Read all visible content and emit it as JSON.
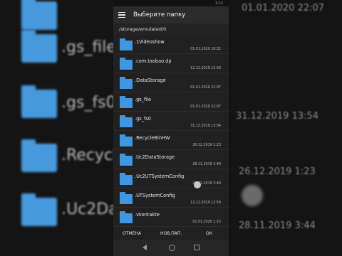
{
  "background": {
    "left_labels": [
      ".gs_file-",
      ".gs_fs0",
      ".Recycl",
      ".Uc2Da"
    ],
    "right_dates": [
      "01.01.2020 22:07",
      "31.12.2019 13:54",
      "26.12.2019 1:23",
      "28.11.2019 3:44"
    ]
  },
  "status_bar": {
    "time": "1:12"
  },
  "dialog": {
    "title": "Выберите папку",
    "path": "/storage/emulated/0",
    "folders": [
      {
        "name": ".1Videoshow",
        "date": "01.01.2020 18:32"
      },
      {
        "name": ".com.taobao.dp",
        "date": "12.12.2019 12:50"
      },
      {
        "name": ".DataStorage",
        "date": "01.01.2020 22:07"
      },
      {
        "name": ".gs_file",
        "date": "01.01.2020 22:07"
      },
      {
        "name": ".gs_fs0",
        "date": "31.12.2019 13:54"
      },
      {
        "name": ".RecycleBinHW",
        "date": "26.12.2019 1:23"
      },
      {
        "name": ".Uc2DataStorage",
        "date": "28.11.2019 3:44"
      },
      {
        "name": ".Uc2UTSystemConfig",
        "date": "28.11.2019 3:44"
      },
      {
        "name": ".UTSystemConfig",
        "date": "12.12.2019 12:50"
      },
      {
        "name": ".vkontakte",
        "date": "02.01.2020 1:15"
      }
    ],
    "actions": {
      "cancel": "ОТМЕНА",
      "new_folder": "НОВ.ПАП.",
      "ok": "ОК"
    }
  },
  "colors": {
    "folder": "#3f97e0",
    "background": "#212121",
    "appbar": "#2b2b2b"
  },
  "icons": {
    "menu": "hamburger-menu-icon",
    "folder": "folder-icon"
  }
}
